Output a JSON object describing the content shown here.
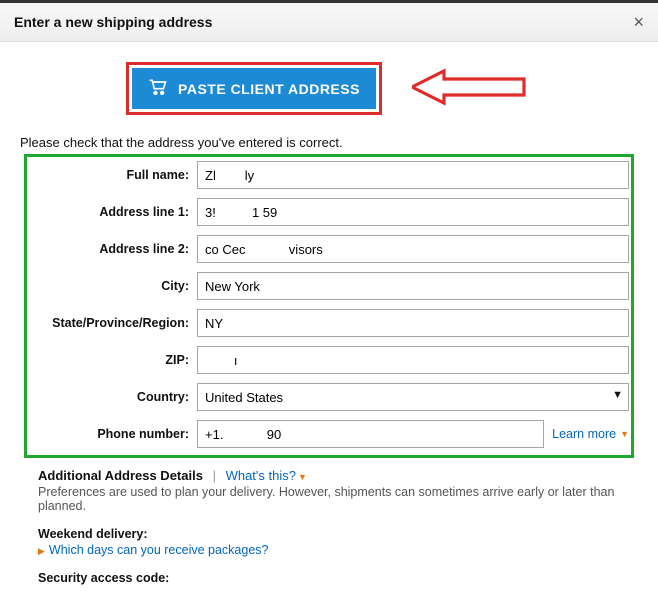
{
  "dialog": {
    "title": "Enter a new shipping address"
  },
  "paste_button": {
    "label": "PASTE CLIENT ADDRESS"
  },
  "instruction": "Please check that the address you've entered is correct.",
  "fields": {
    "full_name": {
      "label": "Full name:",
      "value": "Zl        ly"
    },
    "address1": {
      "label": "Address line 1:",
      "value": "3!          1 59"
    },
    "address2": {
      "label": "Address line 2:",
      "value": "co Cec            visors"
    },
    "city": {
      "label": "City:",
      "value": "New York"
    },
    "state": {
      "label": "State/Province/Region:",
      "value": "NY"
    },
    "zip": {
      "label": "ZIP:",
      "value": "        ı"
    },
    "country": {
      "label": "Country:",
      "value": "United States"
    },
    "phone": {
      "label": "Phone number:",
      "value": "+1.            90",
      "learn_more": "Learn more"
    }
  },
  "additional": {
    "heading": "Additional Address Details",
    "whats_this": "What's this?",
    "desc": "Preferences are used to plan your delivery. However, shipments can sometimes arrive early or later than planned.",
    "weekend_label": "Weekend delivery:",
    "weekend_link": "Which days can you receive packages?",
    "security_label": "Security access code:"
  }
}
